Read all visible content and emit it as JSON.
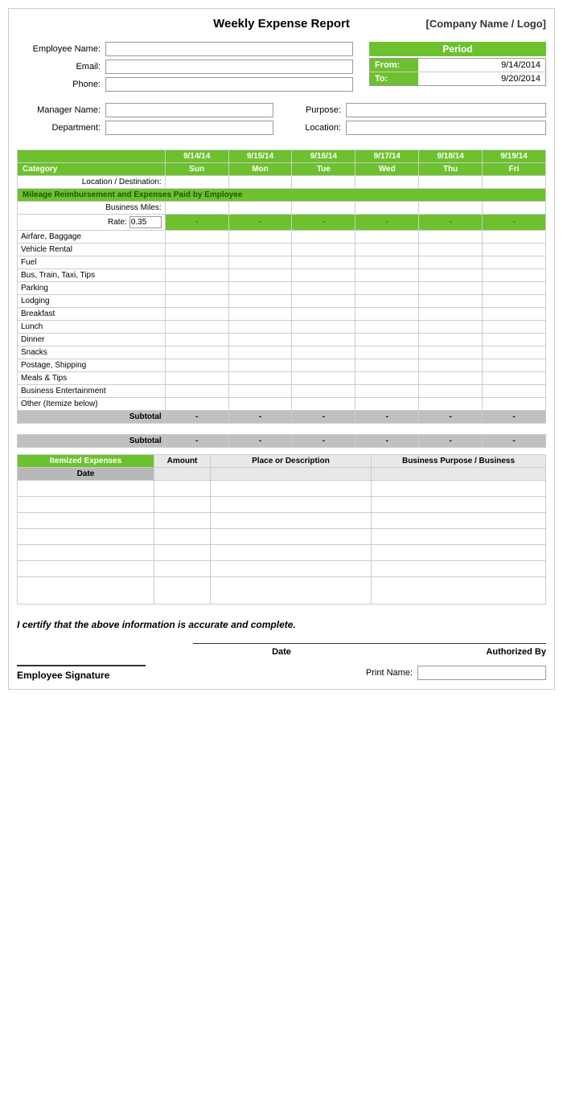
{
  "header": {
    "title": "Weekly Expense Report",
    "company": "[Company Name / Logo]"
  },
  "employee": {
    "name_label": "Employee Name:",
    "email_label": "Email:",
    "phone_label": "Phone:"
  },
  "period": {
    "label": "Period",
    "from_label": "From:",
    "from_value": "9/14/2014",
    "to_label": "To:",
    "to_value": "9/20/2014"
  },
  "manager": {
    "name_label": "Manager Name:",
    "department_label": "Department:",
    "purpose_label": "Purpose:",
    "location_label": "Location:"
  },
  "table": {
    "category_label": "Category",
    "days": [
      {
        "date": "9/14/14",
        "day": "Sun"
      },
      {
        "date": "9/15/14",
        "day": "Mon"
      },
      {
        "date": "9/16/14",
        "day": "Tue"
      },
      {
        "date": "9/17/14",
        "day": "Wed"
      },
      {
        "date": "9/18/14",
        "day": "Thu"
      },
      {
        "date": "9/19/14",
        "day": "Fri"
      }
    ],
    "location_row": "Location / Destination:",
    "mileage_section": "Mileage Reimbursement and Expenses Paid by Employee",
    "business_miles": "Business Miles:",
    "rate_label": "Rate:",
    "rate_value": "0.35",
    "dash": "-",
    "categories": [
      "Airfare, Baggage",
      "Vehicle Rental",
      "Fuel",
      "Bus, Train, Taxi, Tips",
      "Parking",
      "Lodging",
      "Breakfast",
      "Lunch",
      "Dinner",
      "Snacks",
      "Postage, Shipping",
      "Meals & Tips",
      "Business Entertainment",
      "Other (Itemize below)"
    ],
    "subtotal_label": "Subtotal"
  },
  "itemized": {
    "header": "Itemized Expenses",
    "amount_col": "Amount",
    "place_col": "Place or Description",
    "purpose_col": "Business Purpose / Business",
    "date_label": "Date",
    "rows": 7
  },
  "certify_text": "I certify that the above information is accurate and complete.",
  "signature": {
    "date_label": "Date",
    "authorized_label": "Authorized By",
    "employee_sig_label": "Employee Signature",
    "print_name_label": "Print Name:"
  }
}
